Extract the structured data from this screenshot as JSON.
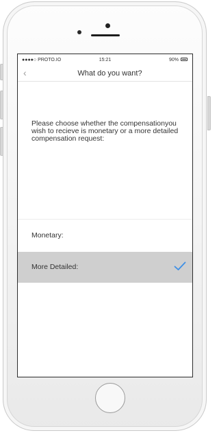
{
  "status_bar": {
    "carrier": "●●●●○ PROTO.IO",
    "time": "15:21",
    "battery": "90%"
  },
  "nav": {
    "back_icon": "chevron-left-icon",
    "title": "What do you want?"
  },
  "prompt": {
    "text": "Please choose whether the compensationyou wish to recieve is monetary or a more detailed compensation request:"
  },
  "options": [
    {
      "label": "Monetary:",
      "selected": false
    },
    {
      "label": "More Detailed:",
      "selected": true
    }
  ],
  "colors": {
    "check_accent": "#3d8fe6",
    "selected_row": "#cfcfcf"
  }
}
